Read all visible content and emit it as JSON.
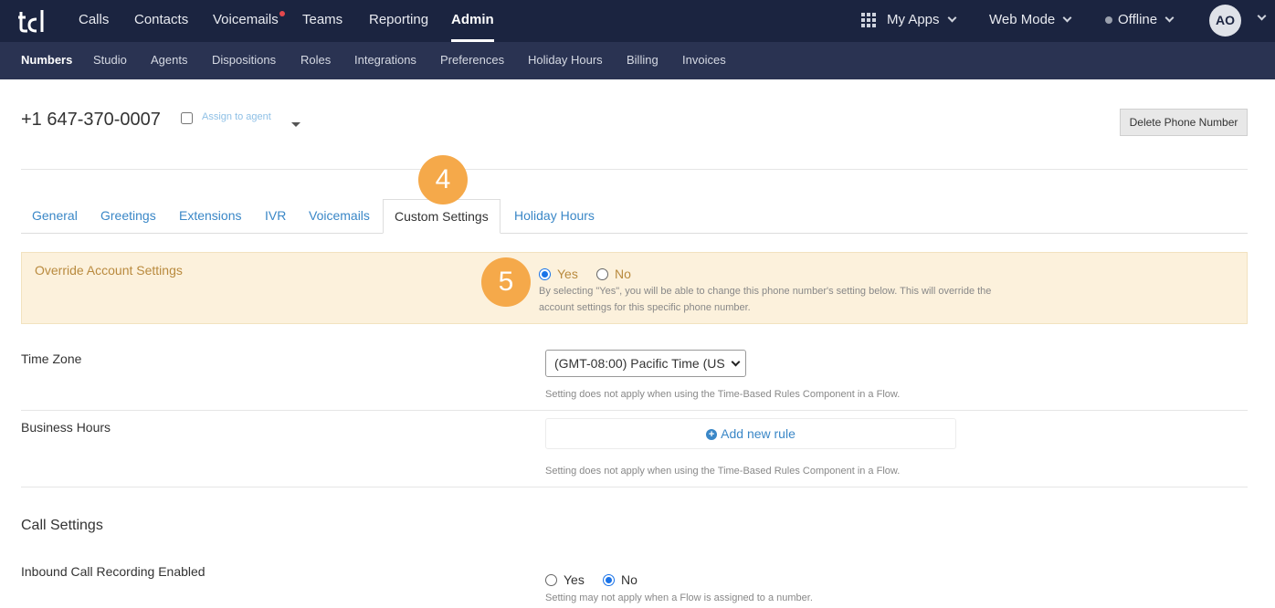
{
  "topnav": {
    "items": [
      {
        "label": "Calls"
      },
      {
        "label": "Contacts"
      },
      {
        "label": "Voicemails"
      },
      {
        "label": "Teams"
      },
      {
        "label": "Reporting"
      },
      {
        "label": "Admin"
      }
    ],
    "my_apps": "My Apps",
    "web_mode": "Web Mode",
    "status": "Offline",
    "avatar_initials": "AO"
  },
  "subnav": {
    "items": [
      {
        "label": "Numbers"
      },
      {
        "label": "Studio"
      },
      {
        "label": "Agents"
      },
      {
        "label": "Dispositions"
      },
      {
        "label": "Roles"
      },
      {
        "label": "Integrations"
      },
      {
        "label": "Preferences"
      },
      {
        "label": "Holiday Hours"
      },
      {
        "label": "Billing"
      },
      {
        "label": "Invoices"
      }
    ]
  },
  "header": {
    "phone_number": "+1 647-370-0007",
    "assign_label": "Assign to agent",
    "delete_label": "Delete Phone Number"
  },
  "tabs": [
    {
      "label": "General"
    },
    {
      "label": "Greetings"
    },
    {
      "label": "Extensions"
    },
    {
      "label": "IVR"
    },
    {
      "label": "Voicemails"
    },
    {
      "label": "Custom Settings"
    },
    {
      "label": "Holiday Hours"
    }
  ],
  "annotations": {
    "step4": "4",
    "step5": "5"
  },
  "override": {
    "label": "Override Account Settings",
    "yes": "Yes",
    "no": "No",
    "selected": "Yes",
    "help_line1": "By selecting \"Yes\", you will be able to change this phone number's setting below. This will override the",
    "help_line2": "account settings for this specific phone number."
  },
  "timezone": {
    "label": "Time Zone",
    "value": "(GMT-08:00) Pacific Time (US",
    "help": "Setting does not apply when using the Time-Based Rules Component in a Flow."
  },
  "business_hours": {
    "label": "Business Hours",
    "add_rule": "Add new rule",
    "help": "Setting does not apply when using the Time-Based Rules Component in a Flow."
  },
  "call_settings": {
    "title": "Call Settings",
    "inbound_label": "Inbound Call Recording Enabled",
    "yes": "Yes",
    "no": "No",
    "selected": "No",
    "help": "Setting may not apply when a Flow is assigned to a number."
  },
  "colors": {
    "topbar": "#1b2440",
    "subbar": "#2a3352",
    "accent_blue": "#3a87c7",
    "badge_orange": "#f5a94a",
    "override_bg": "#fcf1dc"
  }
}
